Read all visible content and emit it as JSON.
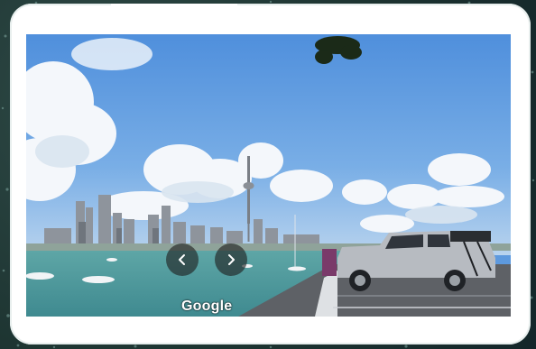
{
  "viewer": {
    "attribution": "Google",
    "prev_icon": "chevron-left-icon",
    "next_icon": "chevron-right-icon"
  },
  "colors": {
    "background": "#1d3431",
    "card": "#ffffff",
    "sky": "#5d99de",
    "water": "#4f9c9e",
    "nav_button": "#1e1e1e"
  }
}
